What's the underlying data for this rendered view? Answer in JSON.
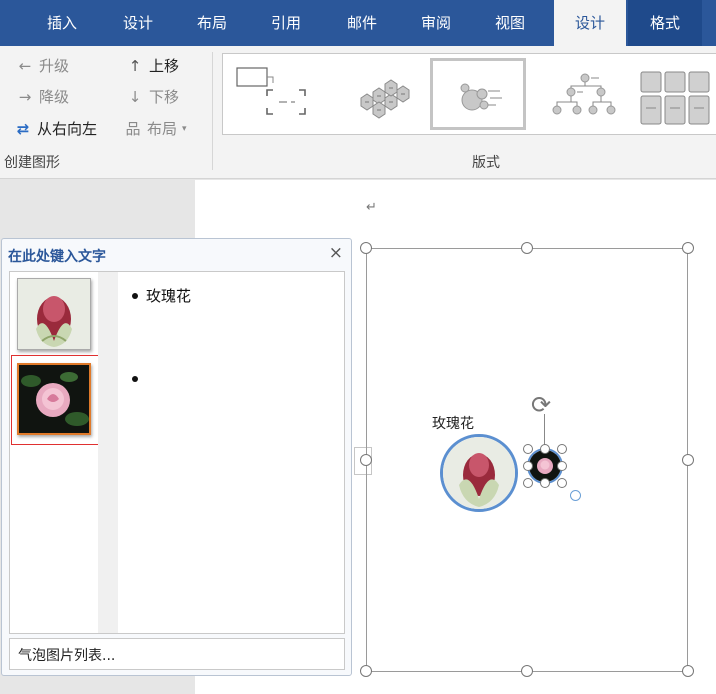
{
  "ribbon_tabs": [
    {
      "label": "插入"
    },
    {
      "label": "设计"
    },
    {
      "label": "布局"
    },
    {
      "label": "引用"
    },
    {
      "label": "邮件"
    },
    {
      "label": "审阅"
    },
    {
      "label": "视图"
    },
    {
      "label": "设计",
      "active": true
    },
    {
      "label": "格式"
    }
  ],
  "create_graphic": {
    "promote": "升级",
    "demote": "降级",
    "right_to_left": "从右向左",
    "move_up": "上移",
    "move_down": "下移",
    "layout": "布局",
    "group_label": "创建图形"
  },
  "layouts": {
    "group_label": "版式",
    "selected_index": 2
  },
  "text_pane": {
    "title": "在此处键入文字",
    "close_glyph": "×",
    "items": [
      {
        "text": "玫瑰花"
      },
      {
        "text": ""
      }
    ],
    "footer": "气泡图片列表..."
  },
  "document": {
    "paragraph_mark": "↵"
  },
  "smartart": {
    "label": "玫瑰花"
  },
  "colors": {
    "tab_bar": "#2b579a",
    "selection_frame": "#e03030",
    "bubble_border": "#5b8fd0"
  }
}
